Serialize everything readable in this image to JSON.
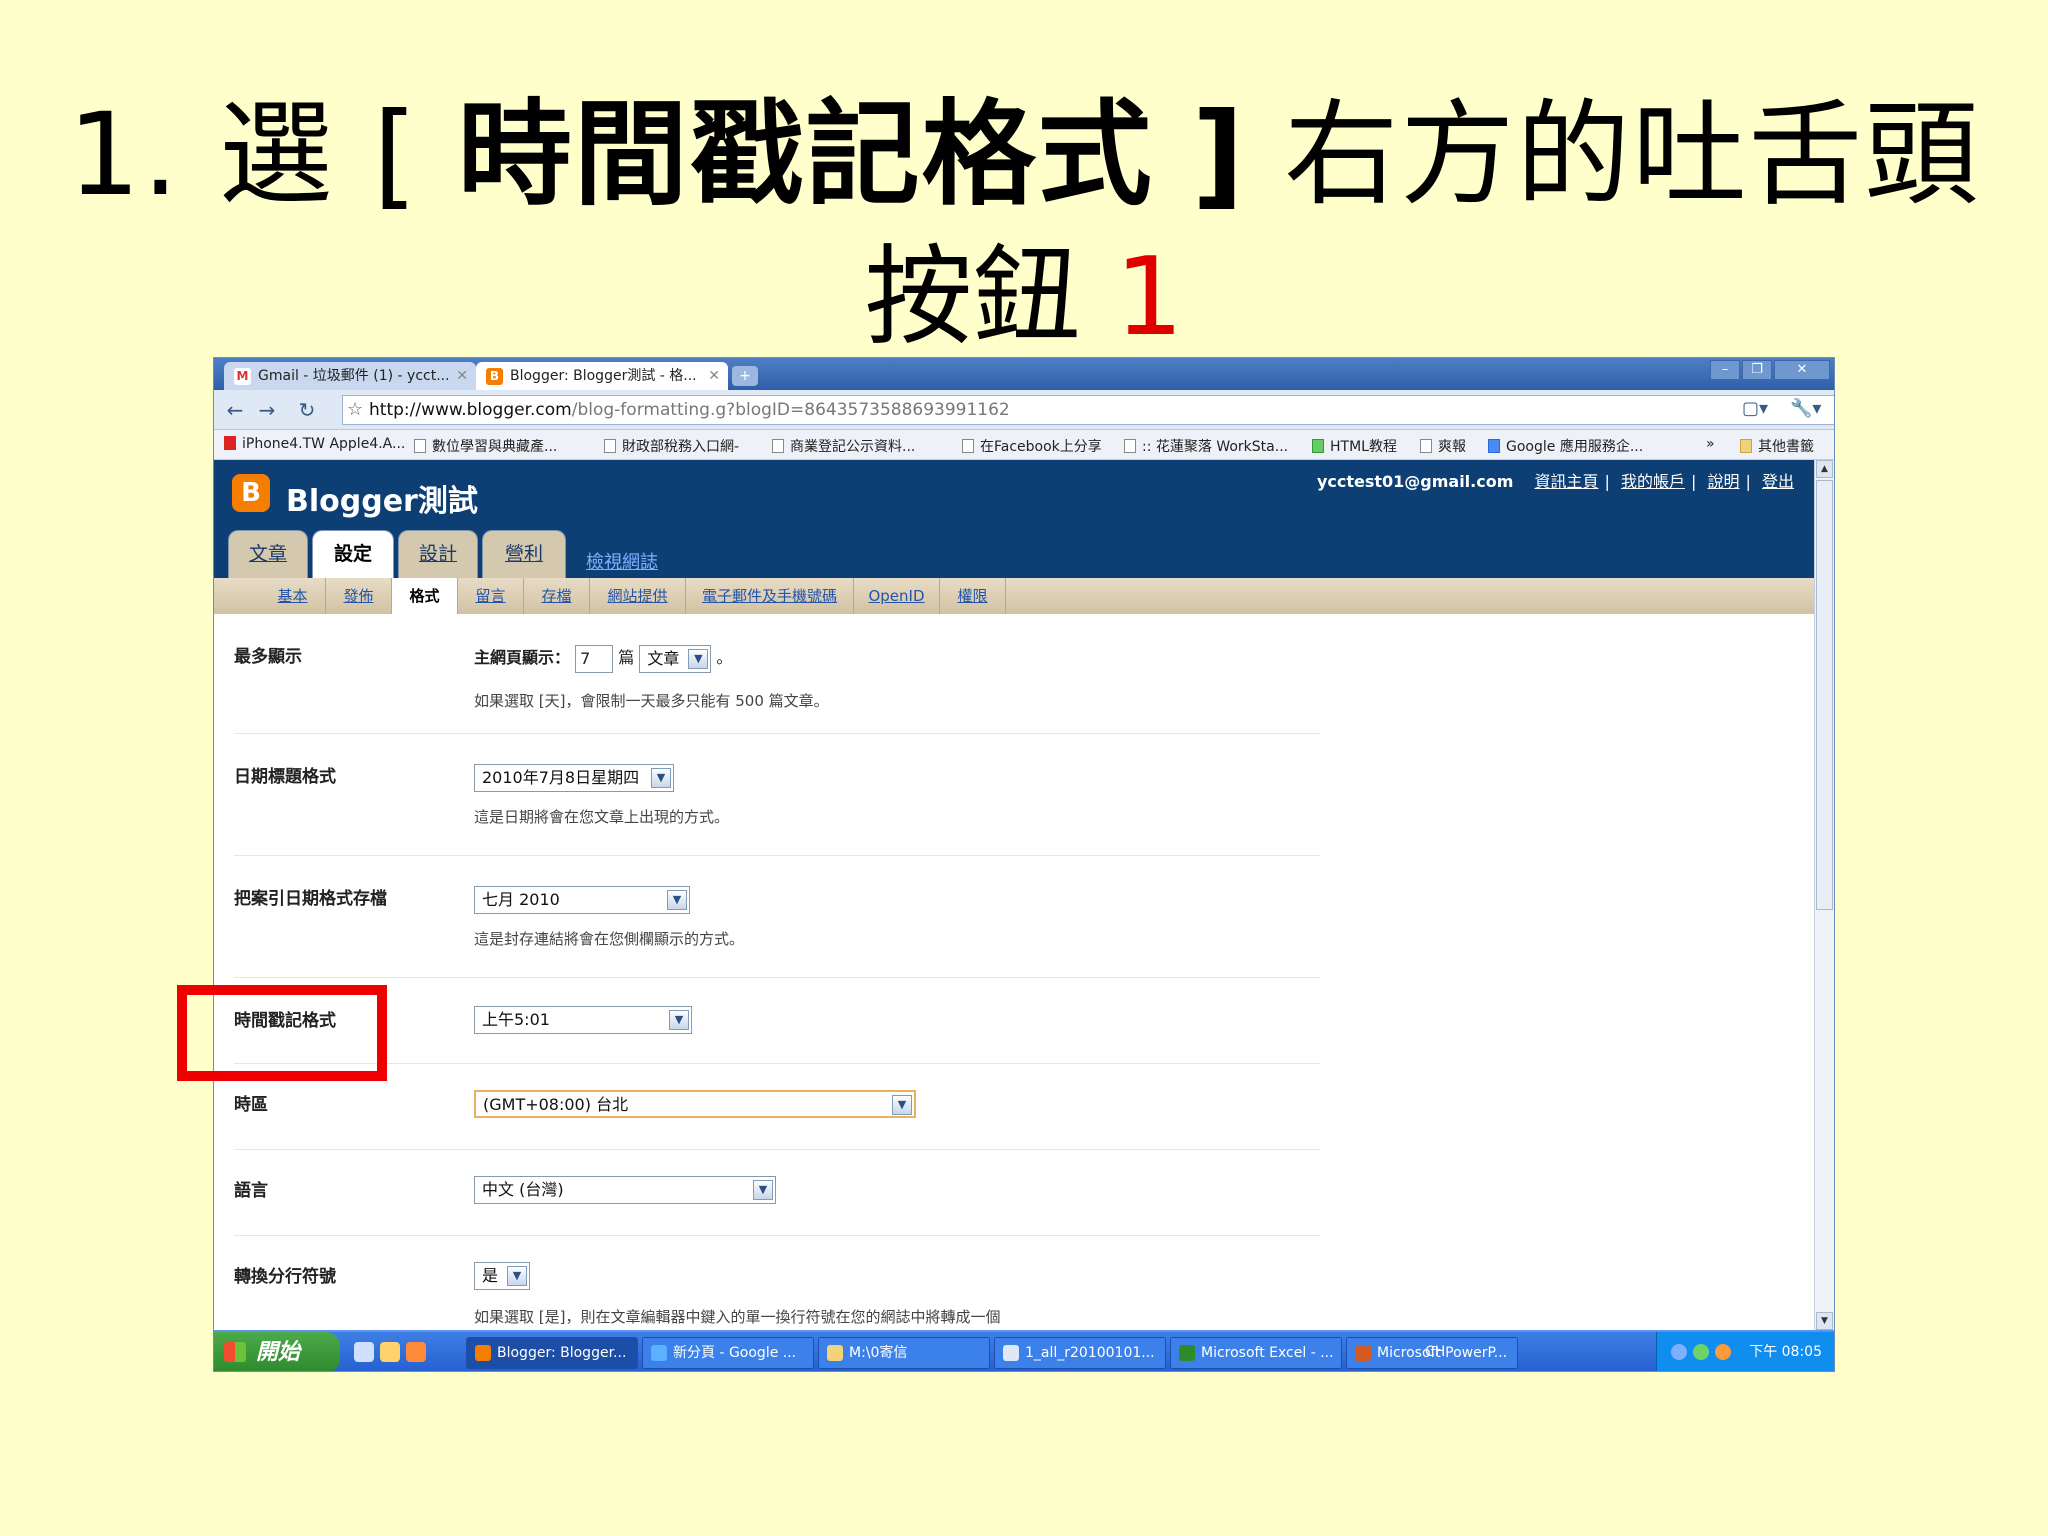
{
  "slide": {
    "title_line1_prefix": "1. 選 [",
    "title_line1_bold": "時間戳記格式",
    "title_line1_close": "]",
    "title_line1_suffix": "右方的吐舌頭",
    "title_line2_text": "按鈕",
    "title_line2_num": "1"
  },
  "browser": {
    "tabs": [
      {
        "label": "Gmail - 垃圾郵件 (1) - ycct...",
        "icon": "gmail-icon"
      },
      {
        "label": "Blogger: Blogger測試 - 格...",
        "icon": "blogger-icon"
      }
    ],
    "url_host": "http://www.blogger.com",
    "url_path": "/blog-formatting.g?blogID=8643573588693991162",
    "bookmarks": [
      "iPhone4.TW Apple4.A...",
      "數位學習與典藏產...",
      "財政部稅務入口網-",
      "商業登記公示資料...",
      "在Facebook上分享",
      ":: 花蓮聚落 WorkSta...",
      "HTML教程",
      "爽報",
      "Google 應用服務企...",
      "其他書籤"
    ]
  },
  "blogger": {
    "blog_title": "Blogger測試",
    "user_email": "ycctest01@gmail.com",
    "nav_links": [
      "資訊主頁",
      "我的帳戶",
      "說明",
      "登出"
    ],
    "main_tabs": [
      "文章",
      "設定",
      "設計",
      "營利"
    ],
    "active_main_tab": "設定",
    "view_blog": "檢視網誌",
    "sub_tabs": [
      "基本",
      "發佈",
      "格式",
      "留言",
      "存檔",
      "網站提供",
      "電子郵件及手機號碼",
      "OpenID",
      "權限"
    ],
    "active_sub_tab": "格式",
    "settings": {
      "max_show": {
        "label": "最多顯示",
        "prefix": "主網頁顯示：",
        "count": "7",
        "unit": "篇",
        "unit_select": "文章",
        "suffix": "。",
        "hint": "如果選取 [天]，會限制一天最多只能有 500 篇文章。"
      },
      "date_header": {
        "label": "日期標題格式",
        "value": "2010年7月8日星期四",
        "hint": "這是日期將會在您文章上出現的方式。"
      },
      "archive_date": {
        "label": "把案引日期格式存檔",
        "value": "七月 2010",
        "hint": "這是封存連結將會在您側欄顯示的方式。"
      },
      "timestamp": {
        "label": "時間戳記格式",
        "value": "上午5:01"
      },
      "timezone": {
        "label": "時區",
        "value": "(GMT+08:00) 台北"
      },
      "language": {
        "label": "語言",
        "value": "中文 (台灣)"
      },
      "line_breaks": {
        "label": "轉換分行符號",
        "value": "是",
        "hint_partial": "如果選取 [是]，則在文章編輯器中鍵入的單一換行符號在您的網誌中將轉成一個"
      }
    }
  },
  "taskbar": {
    "start": "開始",
    "tasks": [
      "Blogger: Blogger...",
      "新分頁 - Google ...",
      "M:\\0寄信",
      "1_all_r20100101...",
      "Microsoft Excel - ...",
      "Microsoft PowerP..."
    ],
    "ime": "CH",
    "clock": "下午 08:05"
  },
  "colors": {
    "slide_bg": "#ffffcc",
    "highlight": "#ee0000",
    "blogger_header": "#0e3f74",
    "blogger_orange": "#f57d00"
  }
}
